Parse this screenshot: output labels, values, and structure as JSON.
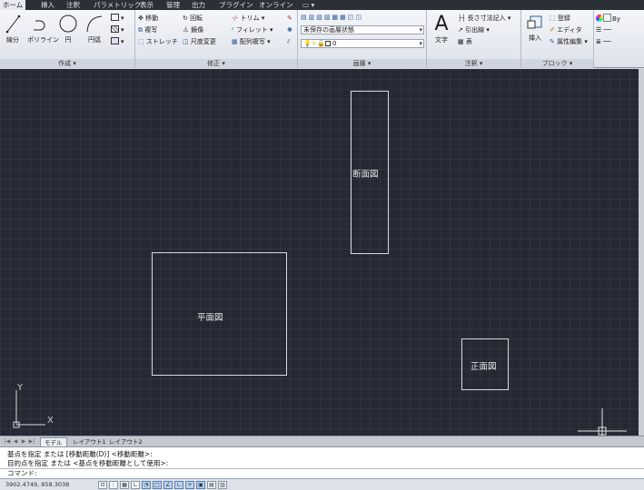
{
  "ribbon_tabs": [
    "ホーム",
    "挿入",
    "注釈",
    "パラメトリック",
    "表示",
    "管理",
    "出力",
    "プラグイン",
    "オンライン",
    "▭ ▾"
  ],
  "panels": {
    "draw": {
      "title": "作成 ▾",
      "line_label": "線分",
      "polyline_label": "ポリライン",
      "circle_label": "円",
      "arc_label": "円弧"
    },
    "modify": {
      "title": "修正 ▾",
      "move": "移動",
      "rotate": "回転",
      "trim": "トリム ▾",
      "copy": "複写",
      "mirror": "鏡像",
      "fillet": "フィレット ▾",
      "stretch": "ストレッチ",
      "scale": "尺度変更",
      "array": "配列複写 ▾"
    },
    "layer": {
      "title": "画層 ▾",
      "state_combo": "未保存の画層状態",
      "layer_combo": "0"
    },
    "annotation": {
      "title": "注釈 ▾",
      "text_label": "文字",
      "linear_dim": "長さ寸法記入 ▾",
      "leader": "引出線 ▾",
      "table": "表"
    },
    "block": {
      "title": "ブロック ▾",
      "insert_label": "挿入",
      "create": "登録",
      "editor": "エディタ",
      "attribute_edit": "属性編集 ▾"
    },
    "properties": {
      "bylayer": "By"
    }
  },
  "drawing": {
    "section_label": "断面図",
    "plan_label": "平面図",
    "elevation_label": "正面図",
    "ucs_y": "Y",
    "ucs_x": "X"
  },
  "layout_tabs": [
    "モデル",
    "レイアウト1",
    "レイアウト2"
  ],
  "command": {
    "history_line1": "基点を指定 または [移動距離(D)] <移動距離>:",
    "history_line2": "目的点を指定 または <基点を移動距離として使用>:",
    "prompt": "コマンド:",
    "input_value": ""
  },
  "status": {
    "coordinates": "3902.4749, 858.3038"
  },
  "colors": {
    "canvas_bg": "#252933",
    "grid": "#2f3440",
    "geometry": "#d8dadd",
    "ribbon_tab_bar": "#2b2f36"
  }
}
